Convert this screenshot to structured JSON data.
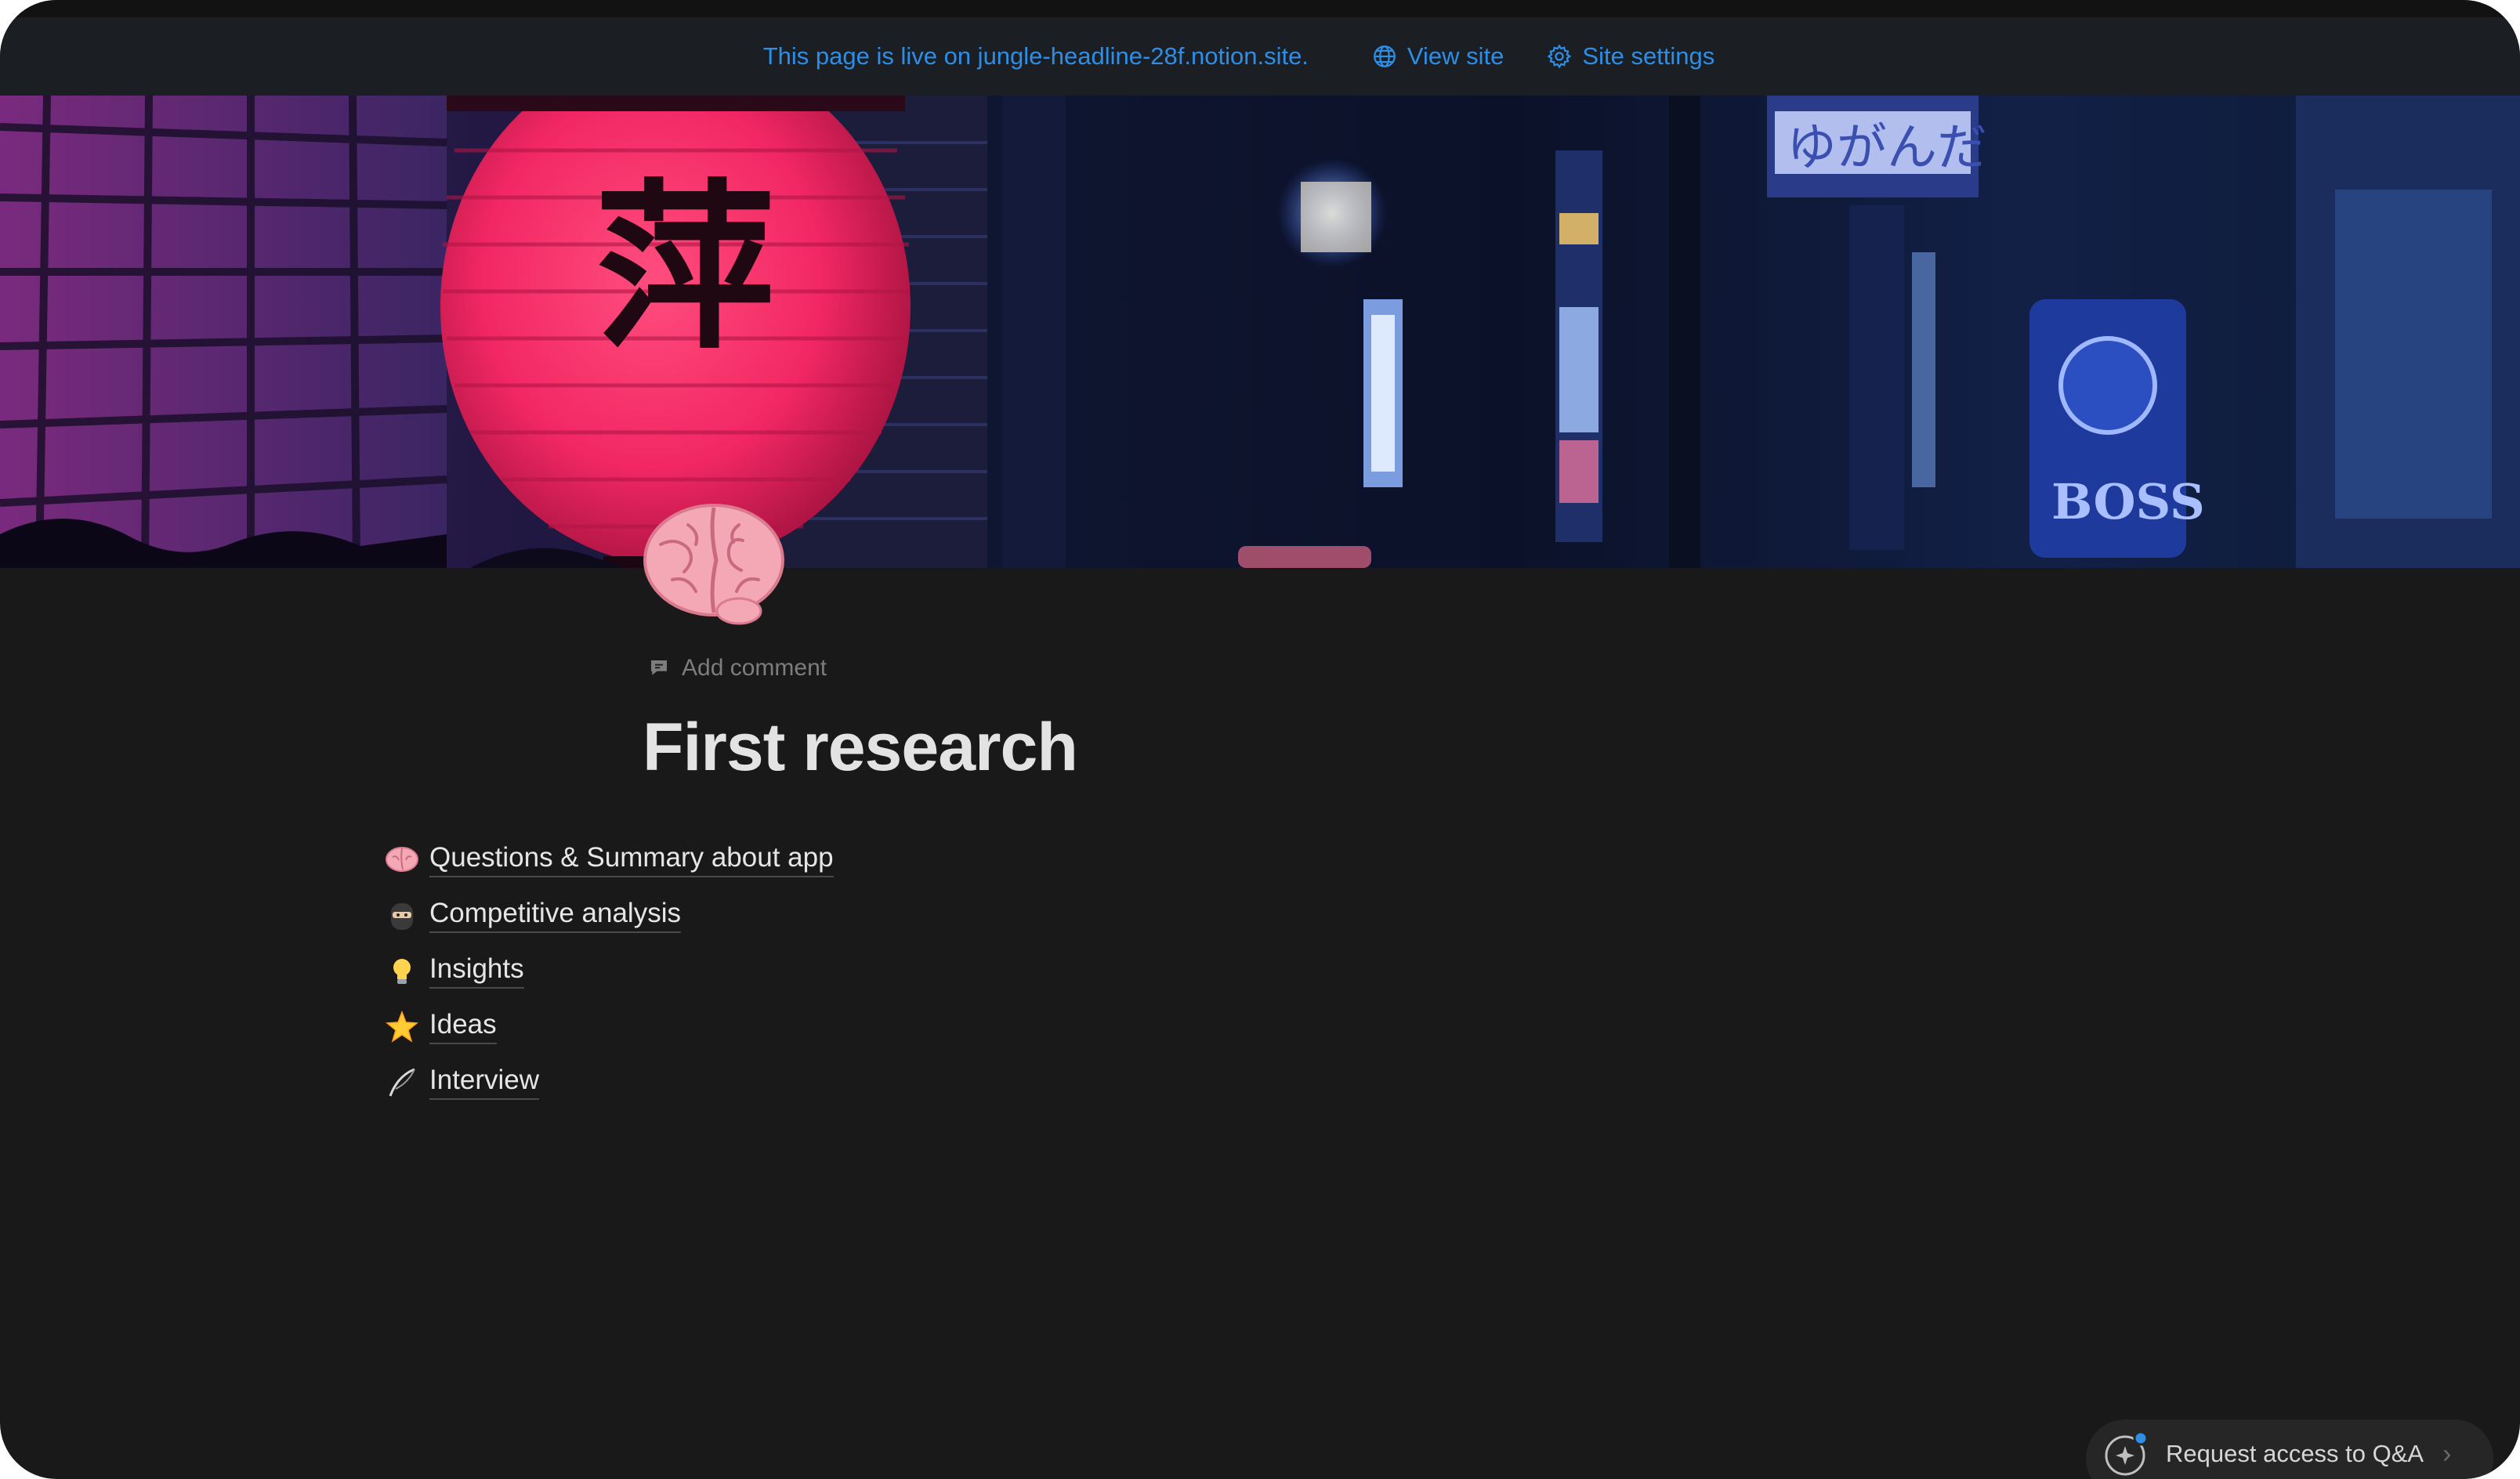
{
  "banner": {
    "live_text": "This page is live on jungle-headline-28f.notion.site.",
    "view_site_label": "View site",
    "site_settings_label": "Site settings",
    "accent_color": "#2e8ee6"
  },
  "cover": {
    "lantern_text": "萍",
    "sign_text": "BOSS",
    "sign_top_text": "ゆがんだ"
  },
  "page": {
    "icon": "brain-icon",
    "add_comment_label": "Add comment",
    "title": "First research"
  },
  "subpages": [
    {
      "icon": "brain-icon",
      "label": "Questions & Summary about app"
    },
    {
      "icon": "ninja-icon",
      "label": "Competitive analysis"
    },
    {
      "icon": "lightbulb-icon",
      "label": "Insights"
    },
    {
      "icon": "glowing-star-icon",
      "label": "Ideas"
    },
    {
      "icon": "feather-icon",
      "label": "Interview"
    }
  ],
  "qa": {
    "label": "Request access to Q&A",
    "chevron": "›"
  }
}
